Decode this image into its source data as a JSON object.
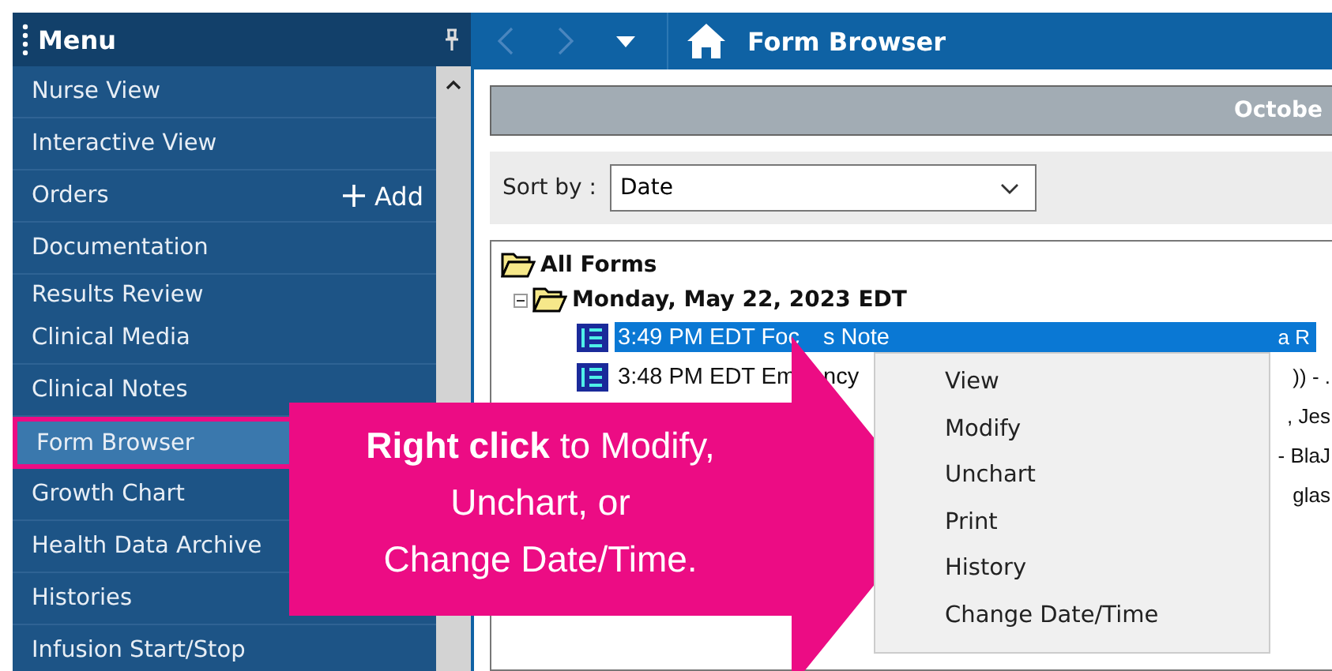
{
  "sidebar": {
    "title": "Menu",
    "items": [
      {
        "label": "Nurse View",
        "selected": false,
        "partial": false
      },
      {
        "label": "Interactive View",
        "selected": false,
        "partial": false
      },
      {
        "label": "Orders",
        "selected": false,
        "partial": false,
        "action": "Add"
      },
      {
        "label": "Documentation",
        "selected": false,
        "partial": false
      },
      {
        "label": "Results Review",
        "selected": false,
        "partial": true
      },
      {
        "label": "Clinical Media",
        "selected": false,
        "partial": false
      },
      {
        "label": "Clinical Notes",
        "selected": false,
        "partial": false
      },
      {
        "label": "Form Browser",
        "selected": true,
        "partial": false
      },
      {
        "label": "Growth Chart",
        "selected": false,
        "partial": false
      },
      {
        "label": "Health Data Archive",
        "selected": false,
        "partial": false
      },
      {
        "label": "Histories",
        "selected": false,
        "partial": false
      },
      {
        "label": "Infusion Start/Stop",
        "selected": false,
        "partial": false
      }
    ]
  },
  "toolbar": {
    "back_disabled": true,
    "forward_disabled": true,
    "title": "Form Browser"
  },
  "banner": {
    "text": "Octobe"
  },
  "sort": {
    "label": "Sort by :",
    "value": "Date"
  },
  "tree": {
    "label": "All Forms",
    "children": [
      {
        "label": "Monday, May 22, 2023 EDT",
        "expanded": true,
        "children": [
          {
            "left": "3:49 PM EDT Foc",
            "middle": "s Note",
            "tail": "a R",
            "selected": true
          },
          {
            "left": "3:48 PM EDT Em",
            "middle": "ncy",
            "tail": ")) - .",
            "selected": false
          },
          {
            "tail": ", Jes",
            "selected": false
          },
          {
            "tail": "- BlaJ",
            "selected": false
          },
          {
            "tail": "glas",
            "selected": false
          }
        ]
      }
    ]
  },
  "context_menu": [
    "View",
    "Modify",
    "Unchart",
    "Print",
    "History",
    "Change Date/Time"
  ],
  "callout": {
    "lines": [
      "**Right click** to Modify,",
      "Unchart, or",
      "Change Date/Time."
    ]
  }
}
